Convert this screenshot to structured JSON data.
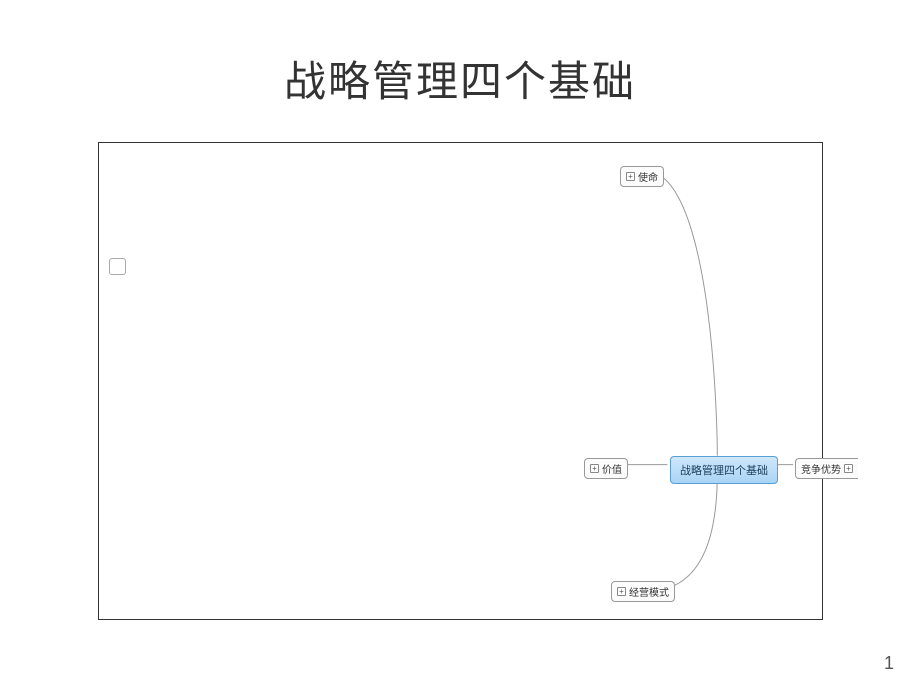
{
  "slide": {
    "title": "战略管理四个基础",
    "page_number": "1"
  },
  "mindmap": {
    "center": {
      "label": "战略管理四个基础"
    },
    "nodes": {
      "top": {
        "label": "使命",
        "expand": "+"
      },
      "left": {
        "label": "价值",
        "expand": "+"
      },
      "right": {
        "label": "竞争优势",
        "expand": "+"
      },
      "bottom": {
        "label": "经营模式",
        "expand": "+"
      }
    }
  }
}
